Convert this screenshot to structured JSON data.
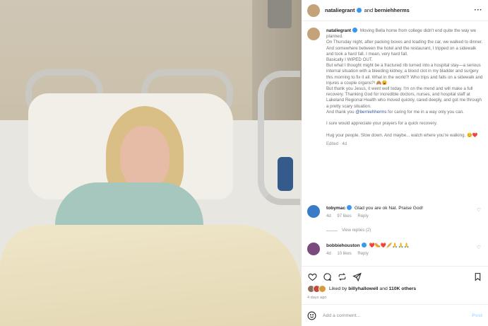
{
  "header": {
    "user1": "nataliegrant",
    "and_text": "and",
    "user2": "berniehherms",
    "more_icon": "more-dots-icon"
  },
  "caption": {
    "username": "nataliegrant",
    "lines": [
      "Moving Bella home from college didn't end quite the way we planned.",
      "On Thursday night, after packing boxes and loading the car, we walked to dinner. And somewhere between the hotel and the restaurant, I tripped on a sidewalk and took a hard fall. I mean, very hard fall.",
      "Basically I WIPED OUT.",
      "But what I thought might be a fractured rib turned into a hospital stay—a serious internal situation with a bleeding kidney, a blood clot in my bladder and surgery this morning to fix it all. What in the world?! Who trips and falls on a sidewalk and injures a couple organs?! 🙈😩",
      "But thank you Jesus, it went well today. I'm on the mend and will make a full recovery. Thanking God for incredible doctors, nurses, and hospital staff at Lakeland Regional Health who moved quickly, cared deeply, and got me through a pretty scary situation."
    ],
    "thanks_pre": "And thank you",
    "thanks_mention": "@berniehherms",
    "thanks_post": "for caring for me in a way only you can.",
    "prayers": "I sure would appreciate your prayers for a quick recovery.",
    "closing": "Hug your people. Slow down. And maybe... watch where you're walking. 😊❤️",
    "meta": "Edited · 4d"
  },
  "comments": [
    {
      "username": "tobymac",
      "text": "Glad you are ok Nat. Praise God!",
      "time": "4d",
      "likes": "97 likes",
      "reply": "Reply",
      "view_replies": "View replies (2)",
      "avatar_color": "#3a7bc8"
    },
    {
      "username": "bobbiehouston",
      "text": "❤️🌭❤️🥖🙏🙏🙏",
      "time": "4d",
      "likes": "10 likes",
      "reply": "Reply",
      "avatar_color": "#7a4a7e"
    }
  ],
  "likes": {
    "prefix": "Liked by",
    "user": "billyhallowell",
    "suffix": "and",
    "others": "110K others"
  },
  "ago": "4 days ago",
  "comment_box": {
    "placeholder": "Add a comment...",
    "post_label": "Post"
  },
  "colors": {
    "accent": "#3897f0",
    "post_disabled": "#b3dbff",
    "like_heart": "#ed4956"
  }
}
